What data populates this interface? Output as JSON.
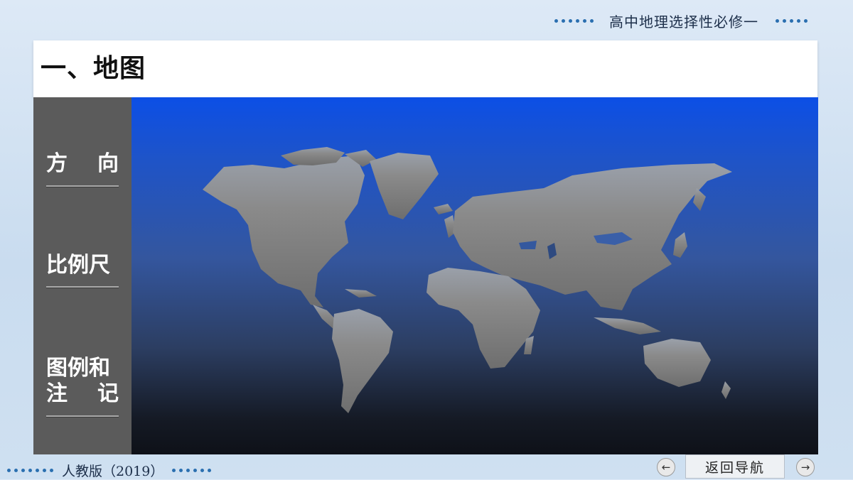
{
  "header": {
    "course_title": "高中地理选择性必修一"
  },
  "section": {
    "title": "一、地图"
  },
  "sidebar": {
    "items": [
      {
        "label_a": "方",
        "label_b": "向"
      },
      {
        "label": "比例尺"
      },
      {
        "line1": "图例和",
        "line2_a": "注",
        "line2_b": "记"
      }
    ]
  },
  "footer": {
    "edition": "人教版（2019）",
    "back_nav_label": "返回导航",
    "prev_icon": "←",
    "next_icon": "→"
  },
  "colors": {
    "accent_dots": "#2a6fb0",
    "sidebar_bg": "#5b5b5b",
    "map_top": "#0c4fe6",
    "map_bottom": "#0e1118"
  }
}
